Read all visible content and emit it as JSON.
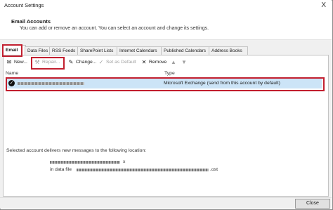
{
  "window": {
    "title": "Account Settings",
    "close_glyph": "X"
  },
  "header": {
    "title": "Email Accounts",
    "description": "You can add or remove an account. You can select an account and change its settings."
  },
  "tabs": [
    {
      "label": "Email"
    },
    {
      "label": "Data Files"
    },
    {
      "label": "RSS Feeds"
    },
    {
      "label": "SharePoint Lists"
    },
    {
      "label": "Internet Calendars"
    },
    {
      "label": "Published Calendars"
    },
    {
      "label": "Address Books"
    }
  ],
  "toolbar": {
    "new_label": "New...",
    "repair_label": "Repair...",
    "change_label": "Change...",
    "set_default_label": "Set as Default",
    "remove_label": "Remove"
  },
  "list": {
    "columns": {
      "name": "Name",
      "type": "Type"
    },
    "rows": [
      {
        "type": "Microsoft Exchange (send from this account by default)",
        "is_default": true
      }
    ]
  },
  "delivery": {
    "label": "Selected account delivers new messages to the following location:",
    "line1_suffix": "x",
    "line2_prefix": "in data file",
    "line2_suffix": ".ost"
  },
  "footer": {
    "close_label": "Close"
  },
  "colors": {
    "highlight": "#c21f2f",
    "selection": "#cce4f7"
  }
}
